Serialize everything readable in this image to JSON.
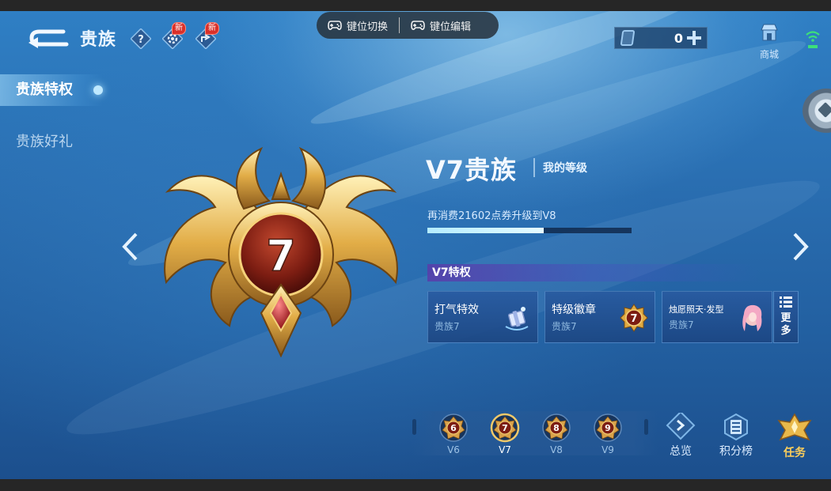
{
  "header": {
    "title": "贵族",
    "new_badge_1": "新",
    "new_badge_2": "新"
  },
  "keymap": {
    "switch_label": "键位切换",
    "edit_label": "键位编辑"
  },
  "currency": {
    "value": "0"
  },
  "shop": {
    "label": "商城"
  },
  "sidebar": {
    "items": [
      {
        "label": "贵族特权",
        "active": true
      },
      {
        "label": "贵族好礼",
        "active": false
      }
    ]
  },
  "emblem": {
    "level": "7"
  },
  "level": {
    "title": "V7贵族",
    "mine_label": "我的等级",
    "upgrade_text": "再消费21602点券升级到V8",
    "progress": 0.57
  },
  "privileges": {
    "header": "V7特权",
    "cards": [
      {
        "name": "打气特效",
        "sub": "贵族7",
        "icon": "gift-box-icon"
      },
      {
        "name": "特级徽章",
        "sub": "贵族7",
        "icon": "level-badge-icon",
        "badge_number": "7"
      },
      {
        "name": "烛愿照天·发型",
        "sub": "贵族7",
        "icon": "hero-portrait-icon"
      }
    ],
    "more_label": "更多"
  },
  "tiers": [
    {
      "label": "V6",
      "number": "6",
      "current": false
    },
    {
      "label": "V7",
      "number": "7",
      "current": true
    },
    {
      "label": "V8",
      "number": "8",
      "current": false
    },
    {
      "label": "V9",
      "number": "9",
      "current": false
    }
  ],
  "bottom_nav": {
    "overview": "总览",
    "ranking": "积分榜",
    "tasks": "任务"
  },
  "colors": {
    "background": "#2a6fb2",
    "progress_fill": "#c8f2ff",
    "gold": "#e9b94b",
    "tasks_label": "#ffcf5a"
  }
}
